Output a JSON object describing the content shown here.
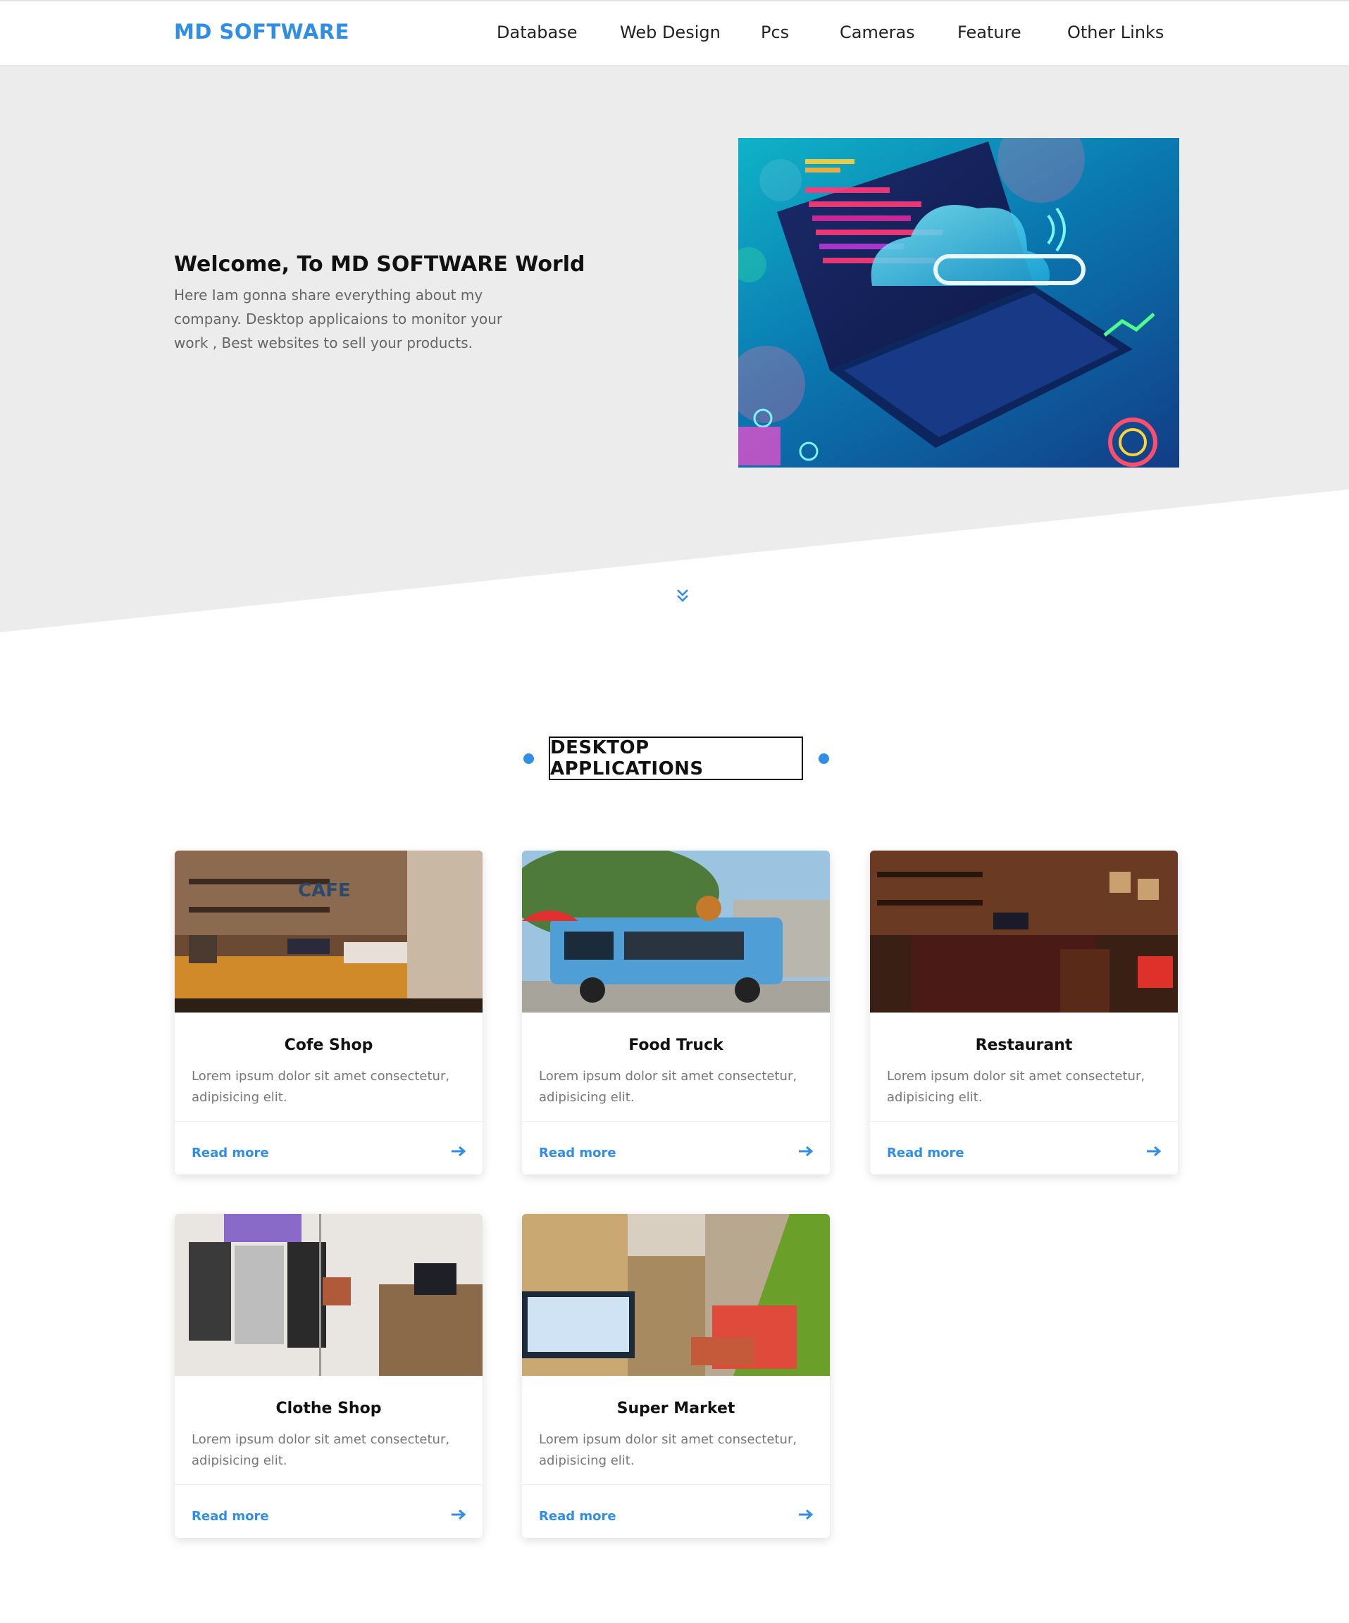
{
  "navbar": {
    "brand": "MD SOFTWARE",
    "links": [
      "Database",
      "Web Design",
      "Pcs",
      "Cameras",
      "Feature",
      "Other Links"
    ]
  },
  "hero": {
    "title": "Welcome, To MD SOFTWARE World",
    "text": "Here Iam gonna share everything about my company. Desktop applicaions to monitor your work , Best websites to sell your products.",
    "image_icon": "laptop-cloud-illustration"
  },
  "section": {
    "title": "DESKTOP APPLICATIONS"
  },
  "cards": [
    {
      "title": "Cofe Shop",
      "text": "Lorem ipsum dolor sit amet consectetur, adipisicing elit.",
      "link": "Read more",
      "image": "cafe-photo"
    },
    {
      "title": "Food Truck",
      "text": "Lorem ipsum dolor sit amet consectetur, adipisicing elit.",
      "link": "Read more",
      "image": "food-truck-photo"
    },
    {
      "title": "Restaurant",
      "text": "Lorem ipsum dolor sit amet consectetur, adipisicing elit.",
      "link": "Read more",
      "image": "restaurant-photo"
    },
    {
      "title": "Clothe Shop",
      "text": "Lorem ipsum dolor sit amet consectetur, adipisicing elit.",
      "link": "Read more",
      "image": "clothe-shop-photo"
    },
    {
      "title": "Super Market",
      "text": "Lorem ipsum dolor sit amet consectetur, adipisicing elit.",
      "link": "Read more",
      "image": "super-market-photo"
    }
  ],
  "colors": {
    "accent": "#2f8ee6",
    "hero_bg": "#ececec",
    "text_muted": "#777777"
  },
  "icons": {
    "scroll": "chevron-double-down-icon",
    "card_arrow": "arrow-right-icon"
  }
}
